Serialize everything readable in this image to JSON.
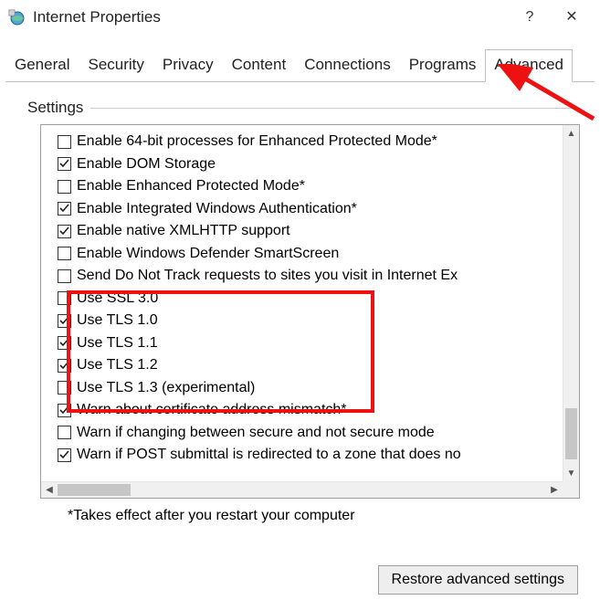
{
  "window": {
    "title": "Internet Properties",
    "help_char": "?",
    "close_char": "✕"
  },
  "tabs": [
    {
      "id": "general",
      "label": "General",
      "active": false
    },
    {
      "id": "security",
      "label": "Security",
      "active": false
    },
    {
      "id": "privacy",
      "label": "Privacy",
      "active": false
    },
    {
      "id": "content",
      "label": "Content",
      "active": false
    },
    {
      "id": "connections",
      "label": "Connections",
      "active": false
    },
    {
      "id": "programs",
      "label": "Programs",
      "active": false
    },
    {
      "id": "advanced",
      "label": "Advanced",
      "active": true
    }
  ],
  "group": {
    "label": "Settings"
  },
  "settings": [
    {
      "checked": false,
      "label": "Enable 64-bit processes for Enhanced Protected Mode*"
    },
    {
      "checked": true,
      "label": "Enable DOM Storage"
    },
    {
      "checked": false,
      "label": "Enable Enhanced Protected Mode*"
    },
    {
      "checked": true,
      "label": "Enable Integrated Windows Authentication*"
    },
    {
      "checked": true,
      "label": "Enable native XMLHTTP support"
    },
    {
      "checked": false,
      "label": "Enable Windows Defender SmartScreen"
    },
    {
      "checked": false,
      "label": "Send Do Not Track requests to sites you visit in Internet Ex"
    },
    {
      "checked": false,
      "label": "Use SSL 3.0"
    },
    {
      "checked": true,
      "label": "Use TLS 1.0"
    },
    {
      "checked": true,
      "label": "Use TLS 1.1"
    },
    {
      "checked": true,
      "label": "Use TLS 1.2"
    },
    {
      "checked": false,
      "label": "Use TLS 1.3 (experimental)"
    },
    {
      "checked": true,
      "label": "Warn about certificate address mismatch*"
    },
    {
      "checked": false,
      "label": "Warn if changing between secure and not secure mode"
    },
    {
      "checked": true,
      "label": "Warn if POST submittal is redirected to a zone that does no"
    }
  ],
  "highlight": {
    "start_index": 7,
    "end_index": 11
  },
  "footnote": "*Takes effect after you restart your computer",
  "buttons": {
    "restore": "Restore advanced settings"
  },
  "annotation": {
    "arrow_color": "#e11",
    "points_to_tab": "advanced"
  }
}
